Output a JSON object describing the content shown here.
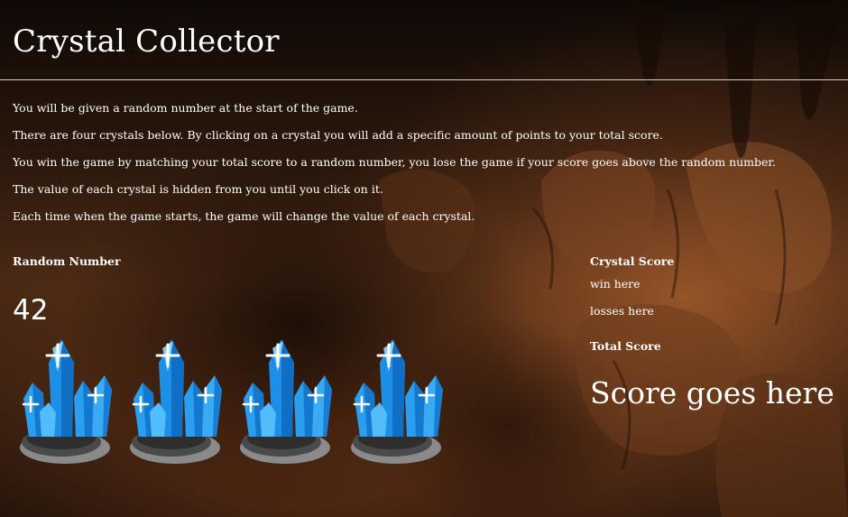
{
  "header": {
    "title": "Crystal Collector"
  },
  "instructions": [
    "You will be given a random number at the start of the game.",
    "There are four crystals below. By clicking on a crystal you will add a specific amount of points to your total score.",
    "You win the game by matching your total score to a random number, you lose the game if your score goes above the random number.",
    "The value of each crystal is hidden from you until you click on it.",
    "Each time when the game starts, the game will change the value of each crystal."
  ],
  "random_number": {
    "label": "Random Number",
    "value": "42"
  },
  "crystals": [
    {
      "icon": "blue-crystal-icon"
    },
    {
      "icon": "blue-crystal-icon"
    },
    {
      "icon": "blue-crystal-icon"
    },
    {
      "icon": "blue-crystal-icon"
    }
  ],
  "scoreboard": {
    "crystal_score_label": "Crystal Score",
    "wins_text": "win here",
    "losses_text": "losses here",
    "total_score_label": "Total Score",
    "total_score_value": "Score goes here"
  },
  "colors": {
    "text": "#ffffff",
    "rule": "#d9d2cc",
    "crystal_blue": "#1e8fe6",
    "crystal_light": "#7fd0ff",
    "rock_gray": "#6c6c6c"
  }
}
